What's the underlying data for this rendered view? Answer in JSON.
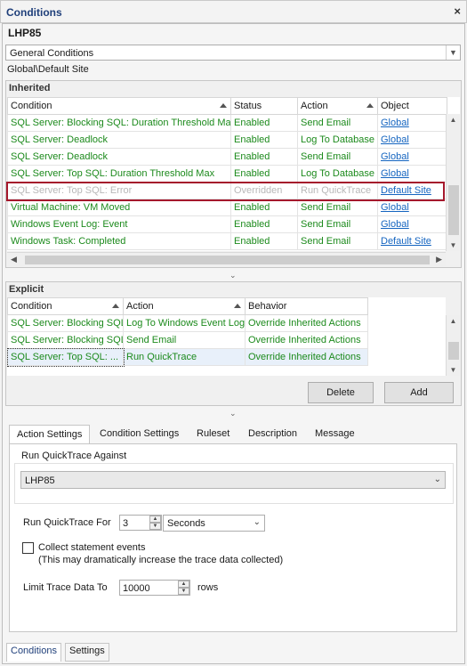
{
  "window": {
    "title": "Conditions",
    "close_glyph": "×"
  },
  "target": "LHP85",
  "category_combo": {
    "value": "General Conditions"
  },
  "breadcrumb": "Global\\Default Site",
  "inherited": {
    "label": "Inherited",
    "columns": [
      "Condition",
      "Status",
      "Action",
      "Object"
    ],
    "rows": [
      {
        "condition": "SQL Server: Blocking SQL: Duration Threshold Max",
        "status": "Enabled",
        "action": "Send Email",
        "object": "Global"
      },
      {
        "condition": "SQL Server: Deadlock",
        "status": "Enabled",
        "action": "Log To Database",
        "object": "Global"
      },
      {
        "condition": "SQL Server: Deadlock",
        "status": "Enabled",
        "action": "Send Email",
        "object": "Global"
      },
      {
        "condition": "SQL Server: Top SQL: Duration Threshold Max",
        "status": "Enabled",
        "action": "Log To Database",
        "object": "Global"
      },
      {
        "condition": "SQL Server: Top SQL: Error",
        "status": "Overridden",
        "action": "Run QuickTrace",
        "object": "Default Site"
      },
      {
        "condition": "Virtual Machine: VM Moved",
        "status": "Enabled",
        "action": "Send Email",
        "object": "Global"
      },
      {
        "condition": "Windows Event Log: Event",
        "status": "Enabled",
        "action": "Send Email",
        "object": "Global"
      },
      {
        "condition": "Windows Task: Completed",
        "status": "Enabled",
        "action": "Send Email",
        "object": "Default Site"
      }
    ]
  },
  "explicit": {
    "label": "Explicit",
    "columns": [
      "Condition",
      "Action",
      "Behavior"
    ],
    "rows": [
      {
        "condition": "SQL Server: Blocking SQL",
        "action": "Log To Windows Event Log",
        "behavior": "Override Inherited Actions"
      },
      {
        "condition": "SQL Server: Blocking SQL",
        "action": "Send Email",
        "behavior": "Override Inherited Actions"
      },
      {
        "condition": "SQL Server: Top SQL: ...",
        "action": "Run QuickTrace",
        "behavior": "Override Inherited Actions"
      }
    ],
    "delete_label": "Delete",
    "add_label": "Add"
  },
  "tabs": [
    "Action Settings",
    "Condition Settings",
    "Ruleset",
    "Description",
    "Message"
  ],
  "action_settings": {
    "run_against_label": "Run QuickTrace Against",
    "run_against_value": "LHP85",
    "run_for_label": "Run QuickTrace For",
    "run_for_value": "3",
    "run_for_unit": "Seconds",
    "collect_label": "Collect statement events",
    "collect_note": "(This may dramatically increase the trace data collected)",
    "limit_label": "Limit Trace Data To",
    "limit_value": "10000",
    "limit_unit": "rows"
  },
  "bottom_tabs": [
    "Conditions",
    "Settings"
  ],
  "colors": {
    "enabled_text": "#1c8a1c",
    "overridden_text": "#b8b8b8",
    "link": "#1565c0",
    "highlight_border": "#a5182c"
  }
}
